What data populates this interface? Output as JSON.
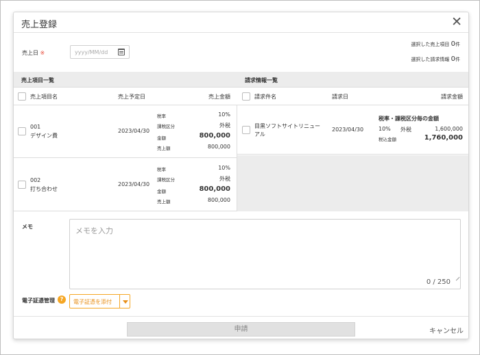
{
  "header": {
    "title": "売上登録"
  },
  "form": {
    "sales_date_label": "売上日",
    "required_mark": "※",
    "date_placeholder": "yyyy/MM/dd"
  },
  "counts": {
    "items_label": "選択した売上項目",
    "items_value": "0",
    "items_unit": "件",
    "invoices_label": "選択した請求情報",
    "invoices_value": "0",
    "invoices_unit": "件"
  },
  "sales_items": {
    "section_title": "売上項目一覧",
    "columns": [
      "売上項目名",
      "売上予定日",
      "売上金額"
    ],
    "detail_labels": [
      "税率",
      "課税区分",
      "金額",
      "売上額"
    ],
    "rows": [
      {
        "code": "001",
        "name": "デザイン費",
        "date": "2023/04/30",
        "tax_rate": "10%",
        "tax_type": "外税",
        "amount": "800,000",
        "sales_amount": "800,000"
      },
      {
        "code": "002",
        "name": "打ち合わせ",
        "date": "2023/04/30",
        "tax_rate": "10%",
        "tax_type": "外税",
        "amount": "800,000",
        "sales_amount": "800,000"
      }
    ]
  },
  "invoices": {
    "section_title": "請求情報一覧",
    "columns": [
      "請求件名",
      "請求日",
      "請求金額"
    ],
    "rows": [
      {
        "name_line1": "目黒ソフトサイトリニュー",
        "name_line2": "アル",
        "date": "2023/04/30",
        "breakdown_title": "税率・課税区分毎の金額",
        "rate": "10%",
        "tax_type": "外税",
        "rate_amount": "1,600,000",
        "total_label": "税込金額",
        "total": "1,760,000"
      }
    ]
  },
  "memo": {
    "label": "メモ",
    "placeholder": "メモを入力",
    "counter": "0 / 250"
  },
  "evidence": {
    "label": "電子証憑管理",
    "help": "?",
    "attach_label": "電子証憑を添付"
  },
  "footer": {
    "submit_label": "申請",
    "cancel_label": "キャンセル"
  },
  "colors": {
    "accent": "#f5a623",
    "required": "#e74c3c",
    "section_bg": "#ececec",
    "disabled_bg": "#e1e1e1"
  }
}
